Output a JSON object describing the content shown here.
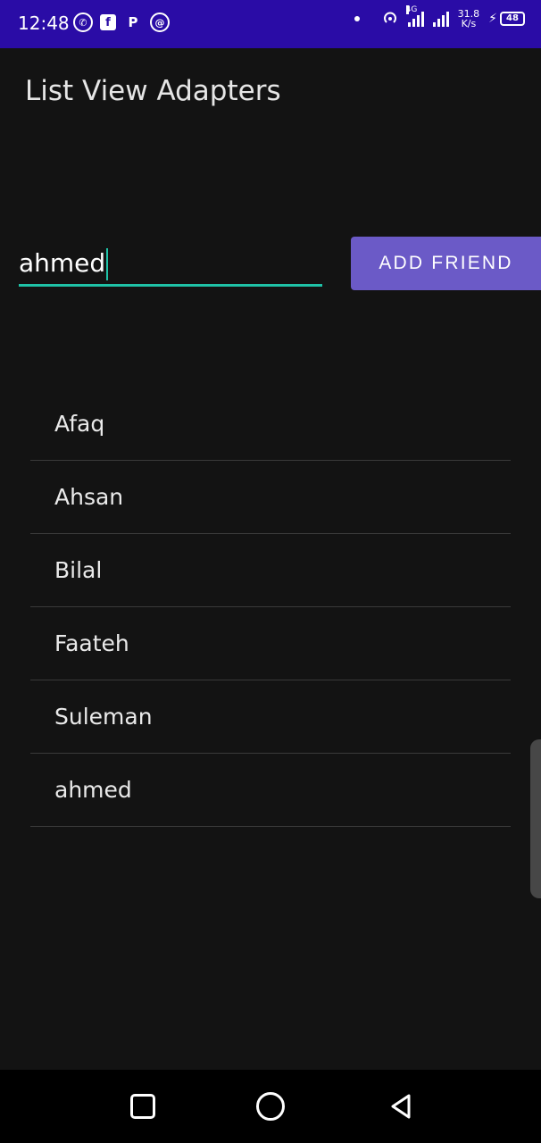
{
  "status_bar": {
    "time": "12:48",
    "apps": [
      {
        "icon": "whatsapp-icon",
        "glyph": "✆"
      },
      {
        "icon": "facebook-icon",
        "glyph": "f"
      },
      {
        "icon": "p-app-icon",
        "glyph": "P"
      },
      {
        "icon": "dialer-icon",
        "glyph": "@"
      }
    ],
    "network": "4G",
    "speed_value": "31.8",
    "speed_unit": "K/s",
    "battery": "48"
  },
  "app": {
    "title": "List View Adapters"
  },
  "form": {
    "input_value": "ahmed",
    "add_button_label": "ADD FRIEND"
  },
  "friends": [
    "Afaq",
    "Ahsan",
    "Bilal",
    "Faateh",
    "Suleman",
    "ahmed"
  ],
  "colors": {
    "status_bar": "#2a0ca6",
    "accent": "#1fc2a7",
    "button": "#6b5ac7",
    "background": "#131313"
  }
}
